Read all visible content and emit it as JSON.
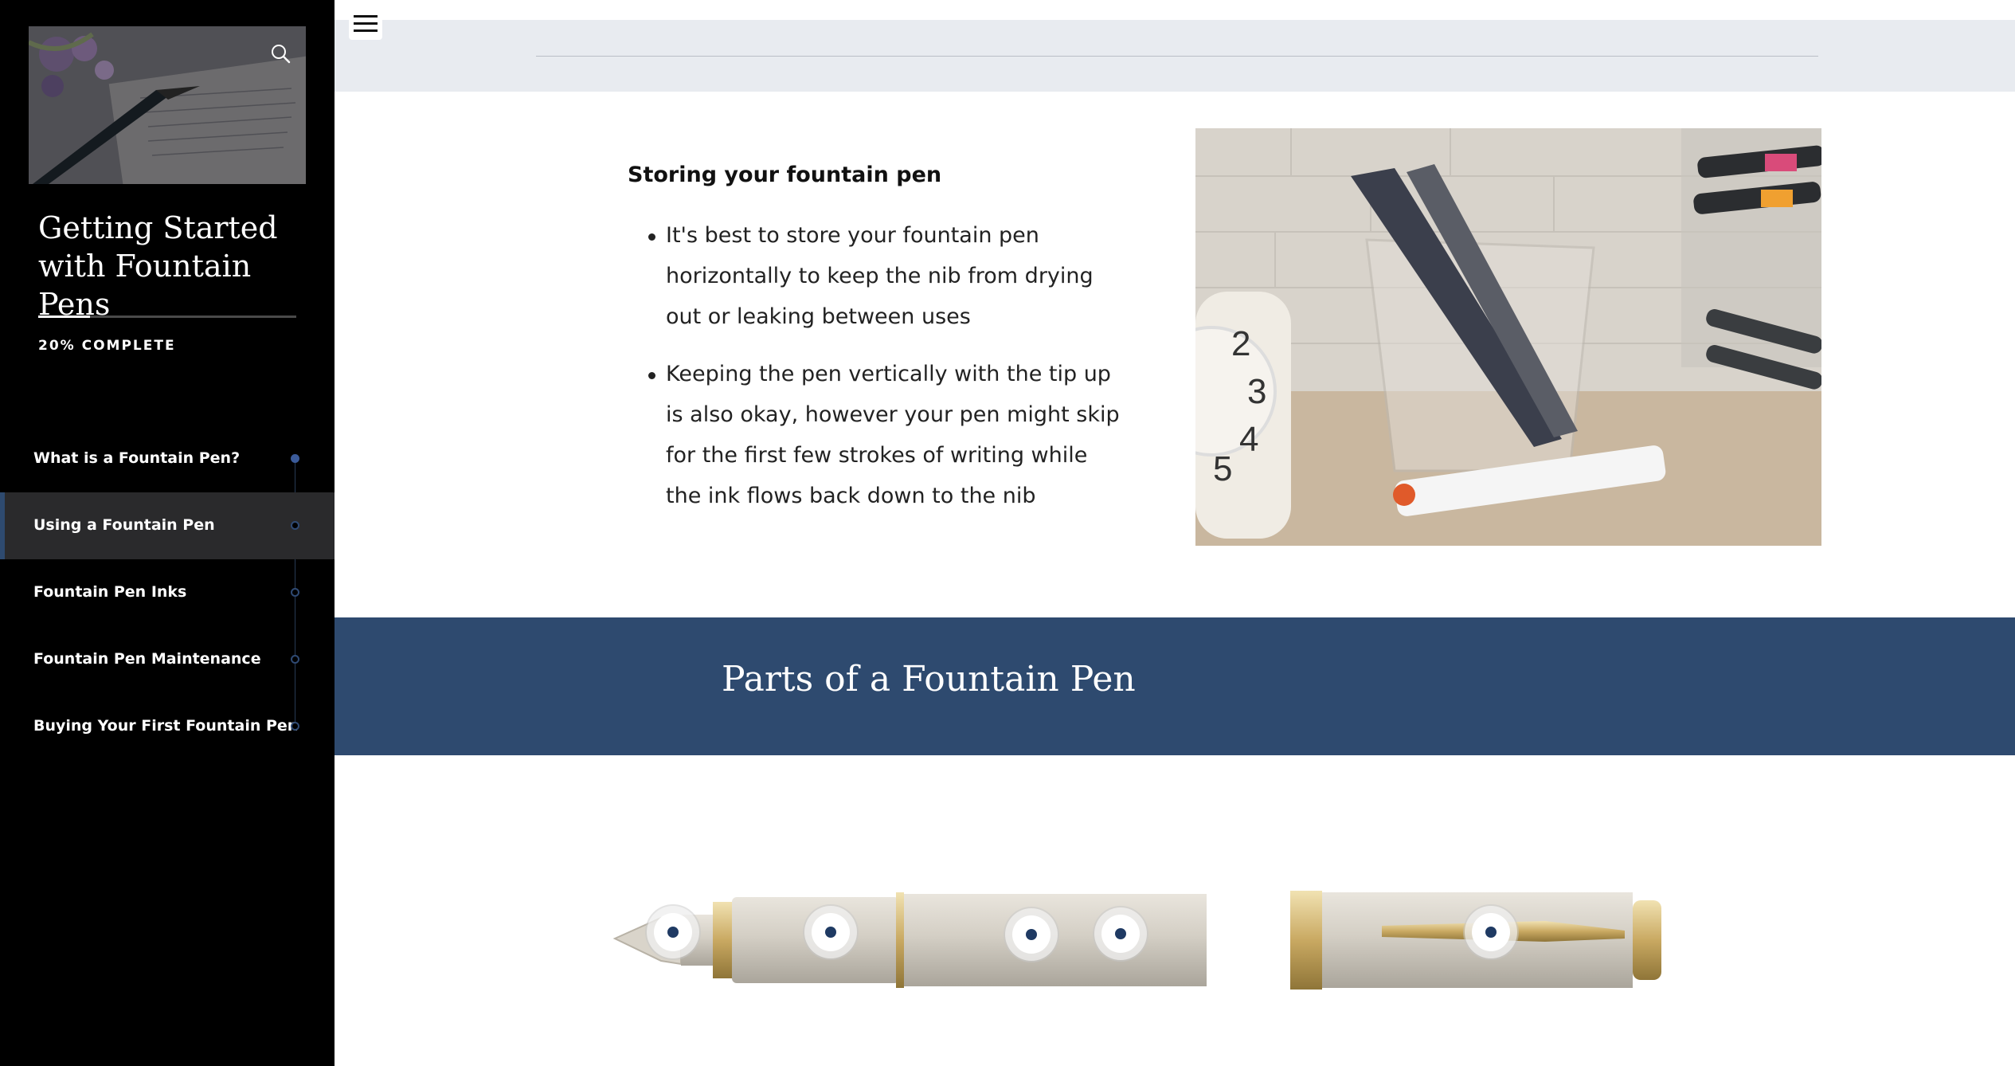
{
  "sidebar": {
    "course_title": "Getting Started with Fountain Pens",
    "progress": {
      "percent": 20,
      "label": "20% COMPLETE"
    },
    "nav": [
      {
        "label": "What is a Fountain Pen?",
        "state": "complete"
      },
      {
        "label": "Using a Fountain Pen",
        "state": "current"
      },
      {
        "label": "Fountain Pen Inks",
        "state": "incomplete"
      },
      {
        "label": "Fountain Pen Maintenance",
        "state": "incomplete"
      },
      {
        "label": "Buying Your First Fountain Pen",
        "state": "incomplete"
      }
    ],
    "icons": {
      "search": "search-icon"
    }
  },
  "header": {
    "menu_icon": "hamburger-menu-icon"
  },
  "content": {
    "storing": {
      "heading": "Storing your fountain pen",
      "bullets": [
        "It's best to store your fountain pen horizontally to keep the nib from drying out or leaking between uses",
        "Keeping the pen vertically with the tip up is also okay, however your pen might skip for the first few strokes of writing while the ink flows back down to the nib"
      ]
    },
    "parts": {
      "title": "Parts of a Fountain Pen",
      "hotspot_count": 5
    }
  },
  "colors": {
    "accent": "#2e4a6f",
    "sidebar_bg": "#000000",
    "top_band": "#e8ebf0",
    "hotspot_dot": "#1f3a63"
  }
}
